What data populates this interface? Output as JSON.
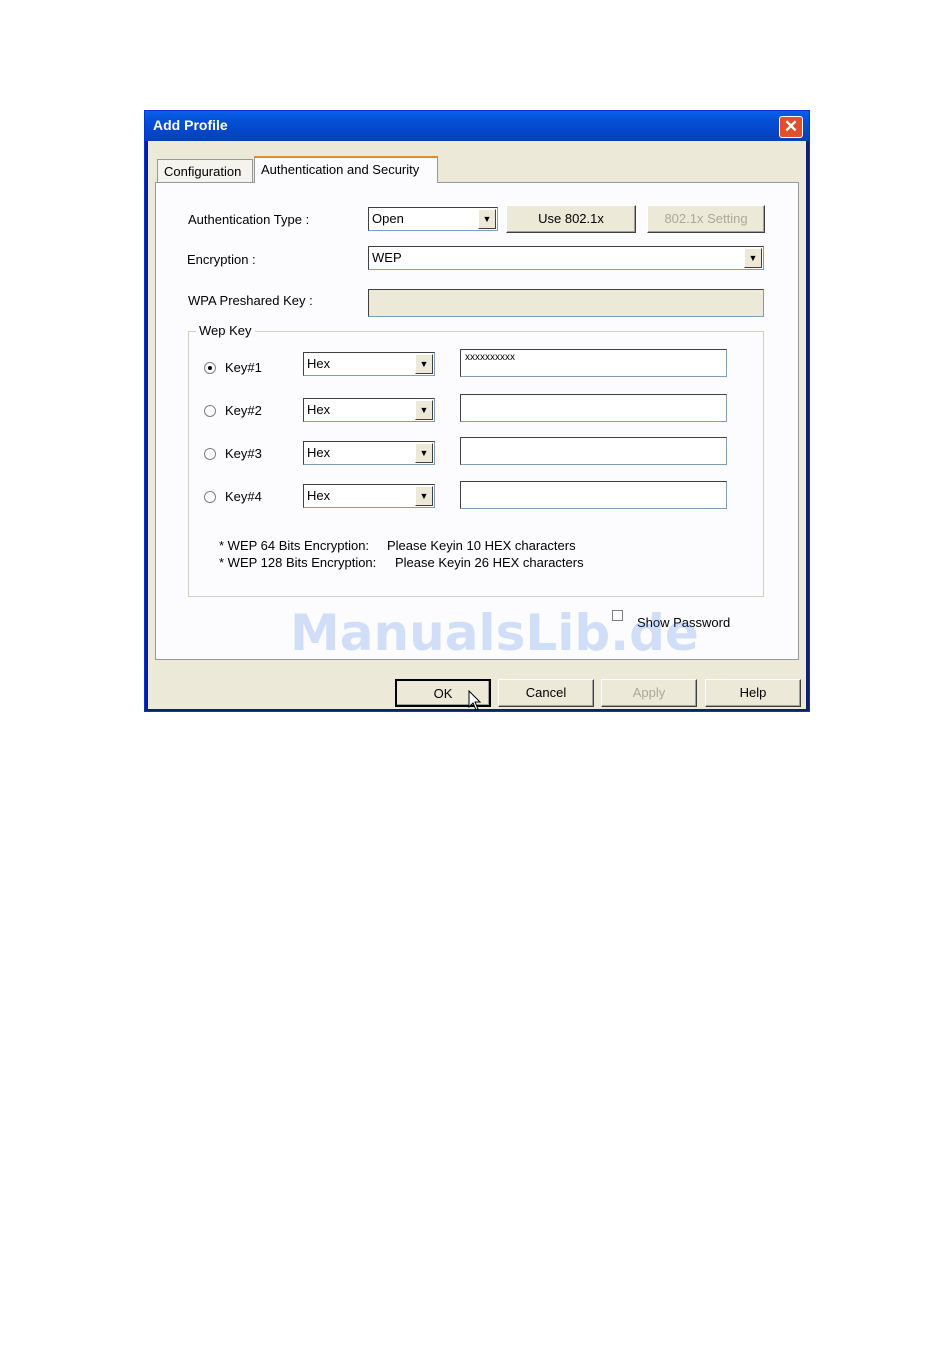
{
  "window": {
    "title": "Add Profile",
    "close_glyph": "✕"
  },
  "tabs": [
    {
      "label": "Configuration",
      "active": false
    },
    {
      "label": "Authentication and Security",
      "active": true
    }
  ],
  "auth": {
    "type_label": "Authentication Type :",
    "type_value": "Open",
    "use8021x_label": "Use 802.1x",
    "setting8021x_label": "802.1x Setting"
  },
  "encryption": {
    "label": "Encryption :",
    "value": "WEP"
  },
  "wpa": {
    "label": "WPA Preshared Key :",
    "value": ""
  },
  "wepkey": {
    "group_label": "Wep Key",
    "keys": [
      {
        "label": "Key#1",
        "selected": true,
        "format": "Hex",
        "value": "xxxxxxxxxx"
      },
      {
        "label": "Key#2",
        "selected": false,
        "format": "Hex",
        "value": ""
      },
      {
        "label": "Key#3",
        "selected": false,
        "format": "Hex",
        "value": ""
      },
      {
        "label": "Key#4",
        "selected": false,
        "format": "Hex",
        "value": ""
      }
    ],
    "note1_a": "* WEP 64 Bits Encryption:",
    "note1_b": "Please Keyin 10 HEX characters",
    "note2_a": "* WEP 128 Bits Encryption:",
    "note2_b": "Please Keyin 26 HEX characters"
  },
  "show_password": {
    "label": "Show Password",
    "checked": false
  },
  "buttons": {
    "ok": "OK",
    "cancel": "Cancel",
    "apply": "Apply",
    "help": "Help"
  },
  "watermark": "ManualsLib.de",
  "colors": {
    "titlebar": "#0350d8",
    "close": "#e0502a",
    "tab_highlight": "#e68b2c",
    "dialog_bg": "#ece9d8"
  }
}
